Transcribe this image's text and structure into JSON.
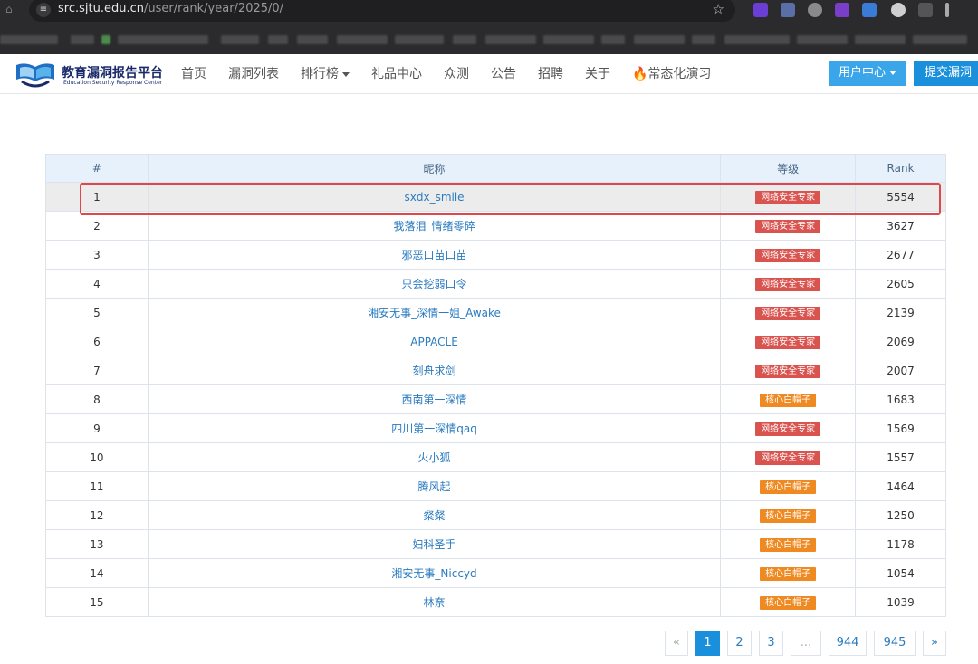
{
  "browser": {
    "url_host": "src.sjtu.edu.cn",
    "url_path": "/user/rank/year/2025/0/"
  },
  "header": {
    "logo_cn": "教育漏洞报告平台",
    "logo_en": "Education Security Response Center",
    "nav": [
      "首页",
      "漏洞列表",
      "排行榜",
      "礼品中心",
      "众测",
      "公告",
      "招聘",
      "关于",
      "🔥常态化演习"
    ],
    "user_center": "用户中心",
    "submit": "提交漏洞"
  },
  "table": {
    "columns": [
      "#",
      "昵称",
      "等级",
      "Rank"
    ],
    "rows": [
      {
        "no": "1",
        "name": "sxdx_smile",
        "level": "网络安全专家",
        "level_type": "expert",
        "rank": "5554"
      },
      {
        "no": "2",
        "name": "我落泪_情绪零碎",
        "level": "网络安全专家",
        "level_type": "expert",
        "rank": "3627"
      },
      {
        "no": "3",
        "name": "邪恶口苗口苗",
        "level": "网络安全专家",
        "level_type": "expert",
        "rank": "2677"
      },
      {
        "no": "4",
        "name": "只会挖弱口令",
        "level": "网络安全专家",
        "level_type": "expert",
        "rank": "2605"
      },
      {
        "no": "5",
        "name": "湘安无事_深情一姐_Awake",
        "level": "网络安全专家",
        "level_type": "expert",
        "rank": "2139"
      },
      {
        "no": "6",
        "name": "APPACLE",
        "level": "网络安全专家",
        "level_type": "expert",
        "rank": "2069"
      },
      {
        "no": "7",
        "name": "刻舟求剑",
        "level": "网络安全专家",
        "level_type": "expert",
        "rank": "2007"
      },
      {
        "no": "8",
        "name": "西南第一深情",
        "level": "核心白帽子",
        "level_type": "core",
        "rank": "1683"
      },
      {
        "no": "9",
        "name": "四川第一深情qaq",
        "level": "网络安全专家",
        "level_type": "expert",
        "rank": "1569"
      },
      {
        "no": "10",
        "name": "火小狐",
        "level": "网络安全专家",
        "level_type": "expert",
        "rank": "1557"
      },
      {
        "no": "11",
        "name": "腾风起",
        "level": "核心白帽子",
        "level_type": "core",
        "rank": "1464"
      },
      {
        "no": "12",
        "name": "粲粲",
        "level": "核心白帽子",
        "level_type": "core",
        "rank": "1250"
      },
      {
        "no": "13",
        "name": "妇科圣手",
        "level": "核心白帽子",
        "level_type": "core",
        "rank": "1178"
      },
      {
        "no": "14",
        "name": "湘安无事_Niccyd",
        "level": "核心白帽子",
        "level_type": "core",
        "rank": "1054"
      },
      {
        "no": "15",
        "name": "林奈",
        "level": "核心白帽子",
        "level_type": "core",
        "rank": "1039"
      }
    ]
  },
  "pagination": {
    "prev": "«",
    "pages": [
      "1",
      "2",
      "3",
      "...",
      "944",
      "945"
    ],
    "active": "1",
    "next": "»"
  },
  "colors": {
    "expert_badge": "#d9534f",
    "core_badge": "#ef8a22",
    "link": "#2a7bbf",
    "primary": "#1a8fdc",
    "highlight_border": "#e0474c"
  }
}
